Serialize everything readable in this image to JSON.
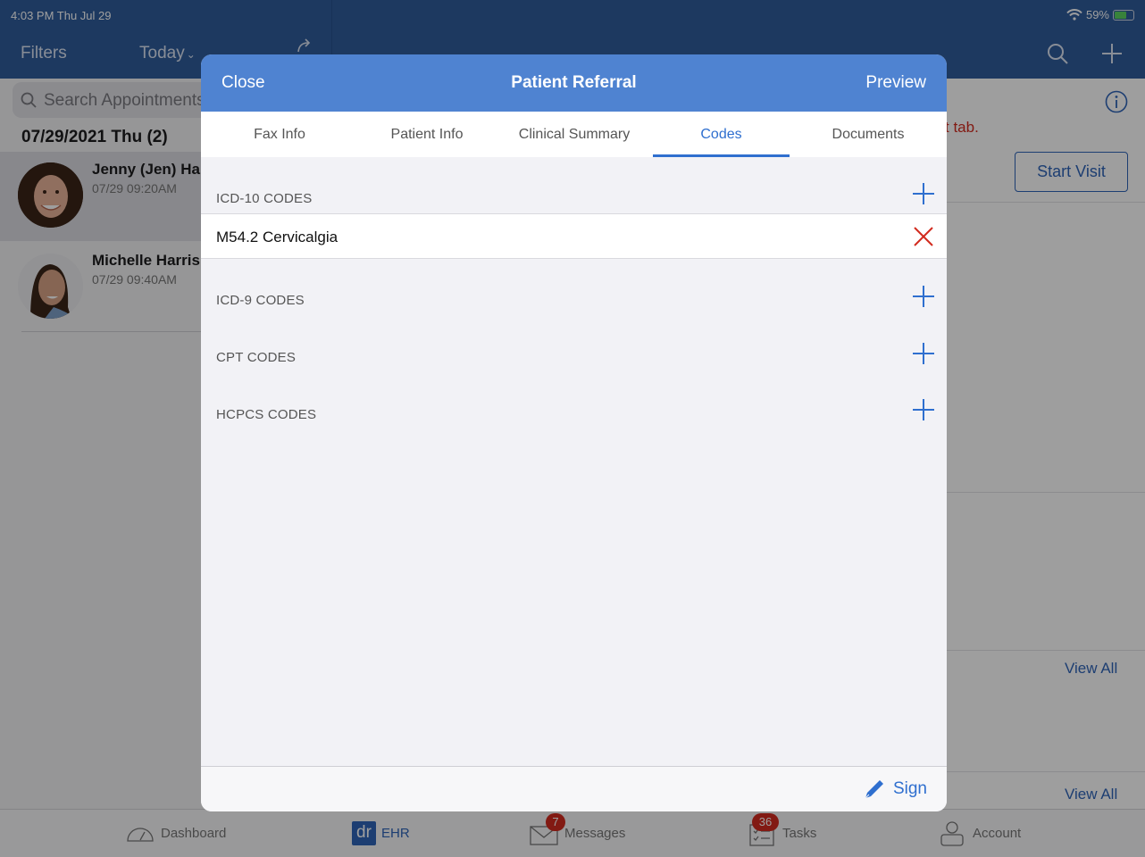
{
  "status_bar": {
    "time": "4:03 PM  Thu Jul 29",
    "battery": "59%",
    "battery_level": 0.59
  },
  "navbar": {
    "filters_label": "Filters",
    "today_label": "Today",
    "today_chevron": "⌄"
  },
  "sidebar": {
    "search_placeholder": "Search Appointments",
    "date_header": "07/29/2021 Thu (2)",
    "patients": [
      {
        "name": "Jenny (Jen) Harris",
        "time": "07/29 09:20AM",
        "selected": true
      },
      {
        "name": "Michelle Harris",
        "time": "07/29 09:40AM",
        "selected": false
      }
    ]
  },
  "detail": {
    "warning_text": "t tab.",
    "start_visit_label": "Start Visit",
    "view_all_1": "View All",
    "view_all_2": "View All"
  },
  "tabbar": {
    "items": [
      {
        "label": "Dashboard",
        "icon": "gauge-icon"
      },
      {
        "label": "EHR",
        "icon": "dr-logo",
        "logo_text": "dr"
      },
      {
        "label": "Messages",
        "icon": "envelope-icon",
        "badge": "7"
      },
      {
        "label": "Tasks",
        "icon": "checklist-icon",
        "badge": "36"
      },
      {
        "label": "Account",
        "icon": "user-icon"
      }
    ]
  },
  "modal": {
    "close_label": "Close",
    "title": "Patient Referral",
    "preview_label": "Preview",
    "tabs": [
      {
        "label": "Fax Info",
        "active": false
      },
      {
        "label": "Patient Info",
        "active": false
      },
      {
        "label": "Clinical Summary",
        "active": false
      },
      {
        "label": "Codes",
        "active": true
      },
      {
        "label": "Documents",
        "active": false
      }
    ],
    "sections": {
      "icd10": {
        "label": "ICD-10 CODES",
        "codes": [
          "M54.2 Cervicalgia"
        ]
      },
      "icd9": {
        "label": "ICD-9 CODES"
      },
      "cpt": {
        "label": "CPT CODES"
      },
      "hcpcs": {
        "label": "HCPCS CODES"
      }
    },
    "sign_label": "Sign"
  },
  "colors": {
    "primary": "#2f5c9c",
    "modal_header": "#4f83d1",
    "accent": "#2f6fcf",
    "danger": "#d22b1f"
  }
}
